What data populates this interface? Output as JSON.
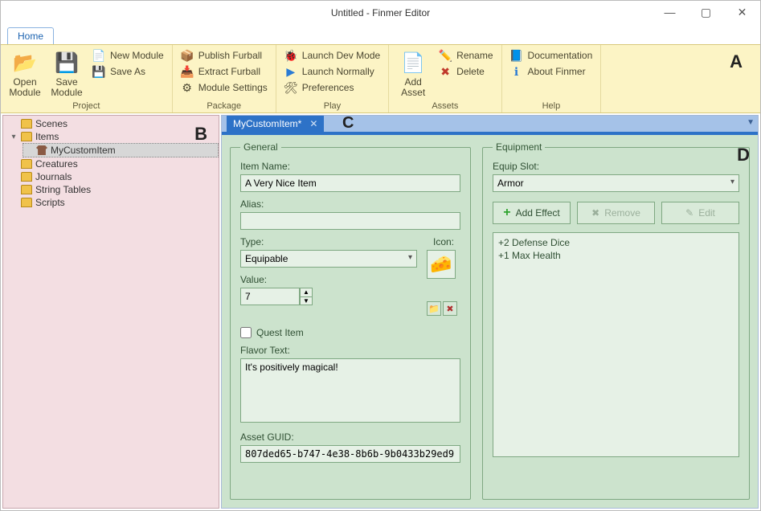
{
  "window": {
    "title": "Untitled - Finmer Editor"
  },
  "tabs": {
    "home": "Home"
  },
  "ribbon": {
    "project": {
      "label": "Project",
      "open": "Open\nModule",
      "save": "Save\nModule",
      "new_module": "New Module",
      "save_as": "Save As"
    },
    "package": {
      "label": "Package",
      "publish": "Publish Furball",
      "extract": "Extract Furball",
      "settings": "Module Settings"
    },
    "play": {
      "label": "Play",
      "dev_mode": "Launch Dev Mode",
      "normal": "Launch Normally",
      "prefs": "Preferences"
    },
    "assets": {
      "label": "Assets",
      "add": "Add\nAsset",
      "rename": "Rename",
      "delete": "Delete"
    },
    "help": {
      "label": "Help",
      "docs": "Documentation",
      "about": "About Finmer"
    }
  },
  "overlay": {
    "A": "A",
    "B": "B",
    "C": "C",
    "D": "D"
  },
  "tree": {
    "scenes": "Scenes",
    "items": "Items",
    "my_item": "MyCustomItem",
    "creatures": "Creatures",
    "journals": "Journals",
    "string_tables": "String Tables",
    "scripts": "Scripts"
  },
  "doc_tab": {
    "name": "MyCustomItem*"
  },
  "general": {
    "legend": "General",
    "item_name_label": "Item Name:",
    "item_name": "A Very Nice Item",
    "alias_label": "Alias:",
    "alias": "",
    "type_label": "Type:",
    "type_value": "Equipable",
    "icon_label": "Icon:",
    "value_label": "Value:",
    "value": "7",
    "quest_item": "Quest Item",
    "flavor_label": "Flavor Text:",
    "flavor": "It's positively magical!",
    "guid_label": "Asset GUID:",
    "guid": "807ded65-b747-4e38-8b6b-9b0433b29ed9"
  },
  "equipment": {
    "legend": "Equipment",
    "slot_label": "Equip Slot:",
    "slot_value": "Armor",
    "add_effect": "Add Effect",
    "remove": "Remove",
    "edit": "Edit",
    "effects": [
      "+2 Defense Dice",
      "+1 Max Health"
    ]
  }
}
